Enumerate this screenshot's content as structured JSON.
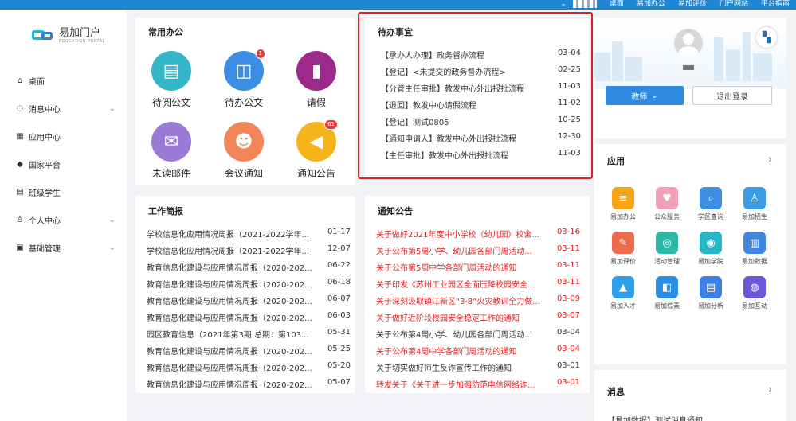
{
  "topnav": {
    "items": [
      "桌面",
      "易加办公",
      "易加评价",
      "门户网站",
      "平台指南"
    ]
  },
  "logo": {
    "name": "易加门户",
    "sub": "EDUCATION PORTAL"
  },
  "sidebar": {
    "items": [
      {
        "label": "桌面",
        "icon": "home-icon",
        "glyph": "⌂",
        "arrow": ""
      },
      {
        "label": "消息中心",
        "icon": "message-icon",
        "glyph": "◌",
        "arrow": "⌄"
      },
      {
        "label": "应用中心",
        "icon": "apps-grid-icon",
        "glyph": "▦",
        "arrow": ""
      },
      {
        "label": "国家平台",
        "icon": "cube-icon",
        "glyph": "◆",
        "arrow": ""
      },
      {
        "label": "班级学生",
        "icon": "class-icon",
        "glyph": "▤",
        "arrow": ""
      },
      {
        "label": "个人中心",
        "icon": "user-icon",
        "glyph": "♙",
        "arrow": "⌄"
      },
      {
        "label": "基础管理",
        "icon": "document-icon",
        "glyph": "▣",
        "arrow": "⌄"
      }
    ]
  },
  "common": {
    "title": "常用办公",
    "tiles": [
      {
        "label": "待阅公文",
        "color": "#33b6c8",
        "glyph": "▤",
        "badge": ""
      },
      {
        "label": "待办公文",
        "color": "#3b8ee4",
        "glyph": "◫",
        "badge": "1"
      },
      {
        "label": "请假",
        "color": "#9b2a8a",
        "glyph": "▮",
        "badge": ""
      },
      {
        "label": "未读邮件",
        "color": "#9b7bd6",
        "glyph": "✉",
        "badge": ""
      },
      {
        "label": "会议通知",
        "color": "#f28558",
        "glyph": "☻",
        "badge": ""
      },
      {
        "label": "通知公告",
        "color": "#f6b31c",
        "glyph": "◀",
        "badge": "61"
      }
    ]
  },
  "todo": {
    "title": "待办事宜",
    "items": [
      {
        "text": "【承办人办理】政务督办流程",
        "date": "03-04"
      },
      {
        "text": "【登记】<未提交的政务督办流程>",
        "date": "02-25"
      },
      {
        "text": "【分管主任审批】教发中心外出报批流程",
        "date": "11-03"
      },
      {
        "text": "【退回】教发中心请假流程",
        "date": "11-02"
      },
      {
        "text": "【登记】测试0805",
        "date": "10-25"
      },
      {
        "text": "【通知申请人】教发中心外出报批流程",
        "date": "12-30"
      },
      {
        "text": "【主任审批】教发中心外出报批流程",
        "date": "11-03"
      }
    ]
  },
  "work": {
    "title": "工作简报",
    "items": [
      {
        "text": "学校信息化应用情况周报（2021-2022学年...",
        "date": "01-17"
      },
      {
        "text": "学校信息化应用情况周报（2021-2022学年...",
        "date": "12-07"
      },
      {
        "text": "教育信息化建设与应用情况周报（2020-202...",
        "date": "06-22"
      },
      {
        "text": "教育信息化建设与应用情况周报（2020-202...",
        "date": "06-18"
      },
      {
        "text": "教育信息化建设与应用情况周报（2020-202...",
        "date": "06-07"
      },
      {
        "text": "教育信息化建设与应用情况周报（2020-202...",
        "date": "06-03"
      },
      {
        "text": "园区教育信息（2021年第3期 总期：第103...",
        "date": "05-31"
      },
      {
        "text": "教育信息化建设与应用情况周报（2020-202...",
        "date": "05-25"
      },
      {
        "text": "教育信息化建设与应用情况周报（2020-202...",
        "date": "05-20"
      },
      {
        "text": "教育信息化建设与应用情况周报（2020-202...",
        "date": "05-07"
      }
    ]
  },
  "notice": {
    "title": "通知公告",
    "items": [
      {
        "text": "关于做好2021年度中小学校（幼儿园）校舍...",
        "date": "03-16",
        "red": true
      },
      {
        "text": "关于公布第5周小学、幼儿园各部门周活动...",
        "date": "03-11",
        "red": true
      },
      {
        "text": "关于公布第5周中学各部门周活动的通知",
        "date": "03-11",
        "red": true
      },
      {
        "text": "关于印发《苏州工业园区全面压降校园安全...",
        "date": "03-11",
        "red": true
      },
      {
        "text": "关于深刻汲取镇江新区“3·8”火灾教训全力做...",
        "date": "03-09",
        "red": true
      },
      {
        "text": "关于做好近阶段校园安全稳定工作的通知",
        "date": "03-07",
        "red": true
      },
      {
        "text": "关于公布第4周小学、幼儿园各部门周活动...",
        "date": "03-04",
        "red": false
      },
      {
        "text": "关于公布第4周中学各部门周活动的通知",
        "date": "03-04",
        "red": true
      },
      {
        "text": "关于切实做好师生反诈宣传工作的通知",
        "date": "03-01",
        "red": false
      },
      {
        "text": "转发关于《关于进一步加强防范电信网络诈...",
        "date": "03-01",
        "red": true
      }
    ]
  },
  "profile": {
    "role": "教师",
    "logout": "退出登录"
  },
  "apps": {
    "title": "应用",
    "items": [
      {
        "label": "易加办公",
        "color": "#f4a51c",
        "glyph": "≡"
      },
      {
        "label": "公众服务",
        "color": "#f1a0b8",
        "glyph": "♥"
      },
      {
        "label": "学区查询",
        "color": "#3c8ee2",
        "glyph": "⌕"
      },
      {
        "label": "易加招生",
        "color": "#3a9be6",
        "glyph": "♙"
      },
      {
        "label": "易加评价",
        "color": "#ee6a4c",
        "glyph": "✎"
      },
      {
        "label": "活动管理",
        "color": "#2bb8a5",
        "glyph": "◎"
      },
      {
        "label": "易加学院",
        "color": "#27b6c6",
        "glyph": "◉"
      },
      {
        "label": "易加数据",
        "color": "#3f86e0",
        "glyph": "▥"
      },
      {
        "label": "易加人才",
        "color": "#2f9ee8",
        "glyph": "▲"
      },
      {
        "label": "易加综素",
        "color": "#2a8fe0",
        "glyph": "◧"
      },
      {
        "label": "易加分析",
        "color": "#3d7fe4",
        "glyph": "▤"
      },
      {
        "label": "易加互动",
        "color": "#6a58d8",
        "glyph": "◍"
      }
    ]
  },
  "messages": {
    "title": "消息",
    "first": "【易加数据】测试消息通知"
  }
}
